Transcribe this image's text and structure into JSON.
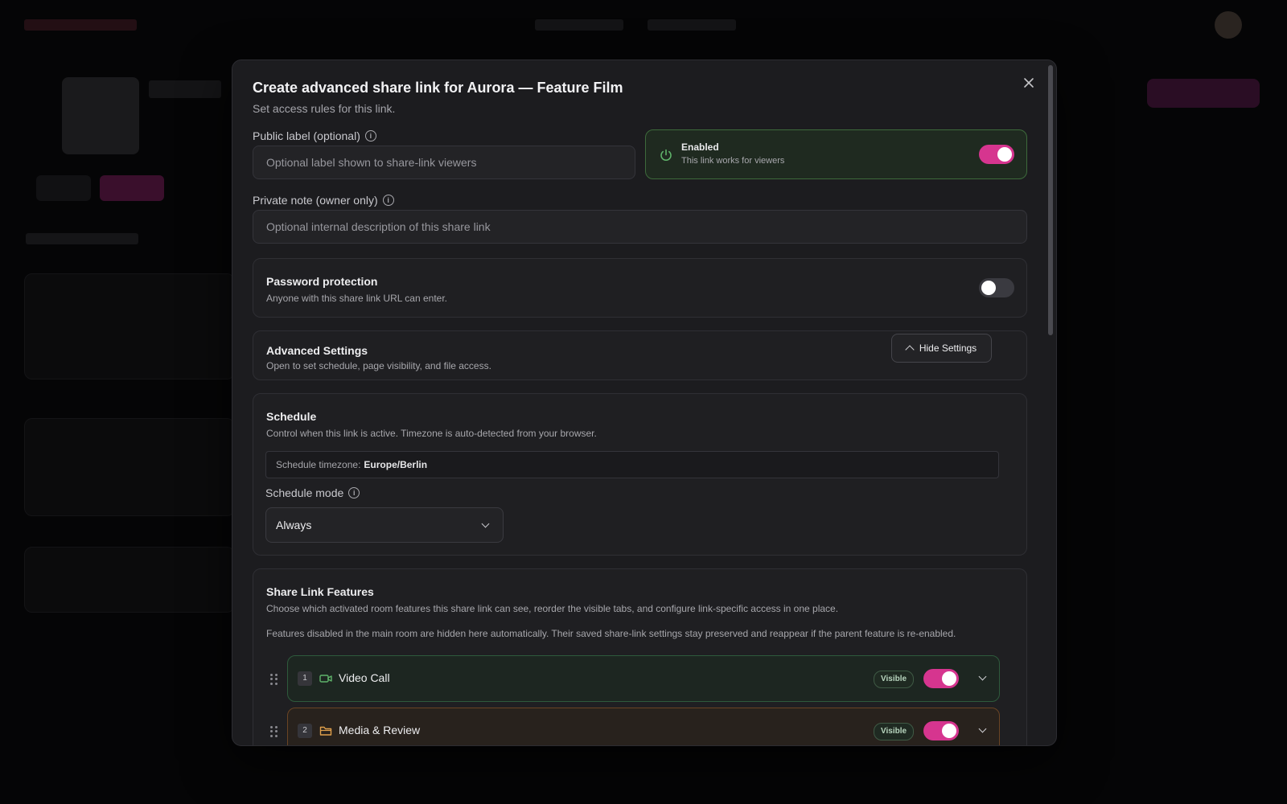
{
  "modal": {
    "title": "Create advanced share link for Aurora — Feature Film",
    "subtitle": "Set access rules for this link.",
    "close_icon": "close-icon"
  },
  "public_label": {
    "label": "Public label (optional)",
    "placeholder": "Optional label shown to share-link viewers",
    "value": ""
  },
  "enabled": {
    "title": "Enabled",
    "subtitle": "This link works for viewers",
    "on": true,
    "icon": "power-icon",
    "accent": "#d6358f"
  },
  "private_note": {
    "label": "Private note (owner only)",
    "placeholder": "Optional internal description of this share link",
    "value": ""
  },
  "password": {
    "title": "Password protection",
    "subtitle": "Anyone with this share link URL can enter.",
    "on": false
  },
  "advanced": {
    "title": "Advanced Settings",
    "subtitle": "Open to set schedule, page visibility, and file access.",
    "button_label": "Hide Settings"
  },
  "schedule": {
    "title": "Schedule",
    "subtitle": "Control when this link is active. Timezone is auto-detected from your browser.",
    "timezone_label": "Schedule timezone:",
    "timezone_value": "Europe/Berlin",
    "mode_label": "Schedule mode",
    "mode_value": "Always"
  },
  "features": {
    "title": "Share Link Features",
    "subtitle": "Choose which activated room features this share link can see, reorder the visible tabs, and configure link-specific access in one place.",
    "note": "Features disabled in the main room are hidden here automatically. Their saved share-link settings stay preserved and reappear if the parent feature is re-enabled.",
    "items": [
      {
        "index": "1",
        "label": "Video Call",
        "badge": "Visible",
        "icon": "video-camera-icon",
        "on": true
      },
      {
        "index": "2",
        "label": "Media & Review",
        "badge": "Visible",
        "icon": "folder-icon",
        "on": true
      }
    ]
  }
}
